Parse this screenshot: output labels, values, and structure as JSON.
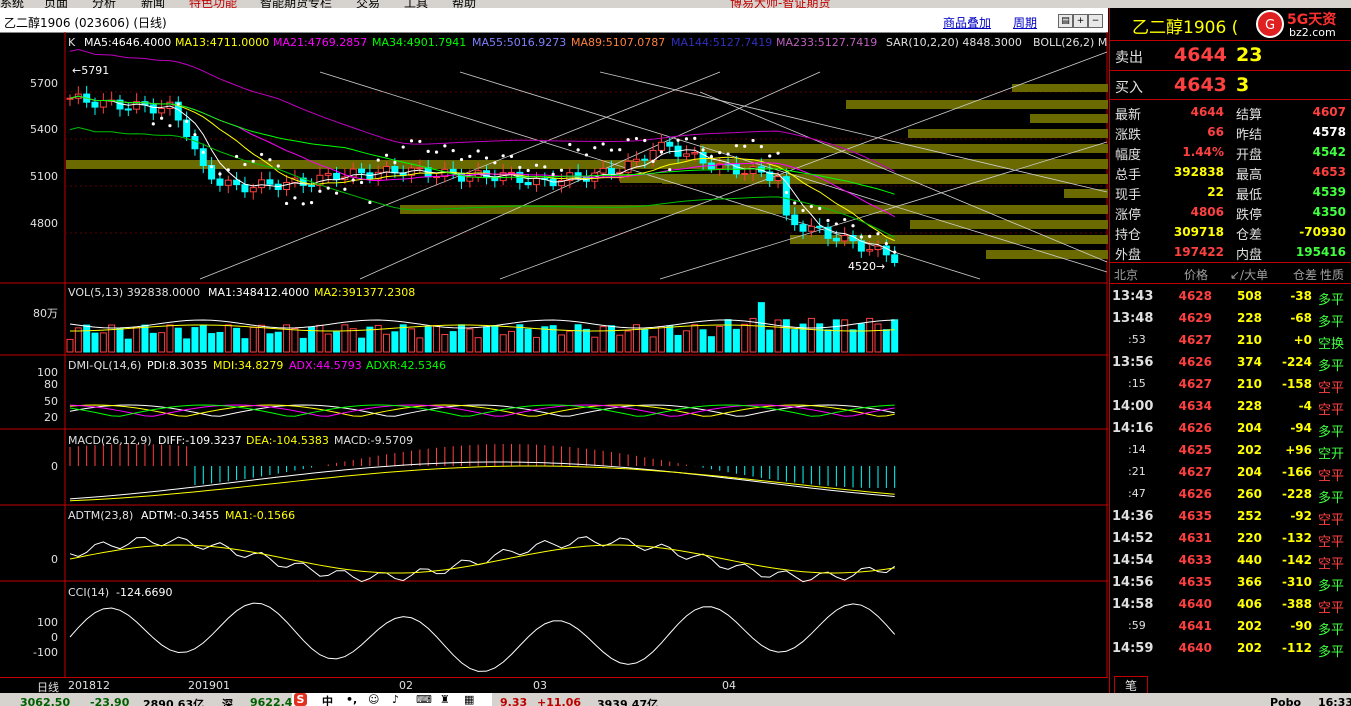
{
  "menu": [
    "系统",
    "页面",
    "分析",
    "新闻",
    "特色功能",
    "智能期货专栏",
    "交易",
    "工具",
    "帮助"
  ],
  "menu_banner": "博易大师-智证期货",
  "title": "乙二醇1906 (023606) (日线)",
  "toolbar_links": [
    "商品叠加",
    "周期"
  ],
  "ma_line": {
    "k": "K",
    "ma5": "MA5:4646.4000",
    "ma13": "MA13:4711.0000",
    "ma21": "MA21:4769.2857",
    "ma34": "MA34:4901.7941",
    "ma55": "MA55:5016.9273",
    "ma89": "MA89:5107.0787",
    "ma144": "MA144:5127.7419",
    "ma233": "MA233:5127.7419",
    "sar": "SAR(10,2,20)  4848.3000",
    "boll": "BOLL(26,2) M"
  },
  "price_axis": [
    "5700",
    "5400",
    "5100",
    "4800"
  ],
  "high_mark": "5791",
  "low_mark": "4520",
  "vol_line": {
    "a": "VOL(5,13)  392838.0000",
    "b": "MA1:348412.4000",
    "c": "MA2:391377.2308"
  },
  "vol_axis": "80万",
  "dmi_line": {
    "a": "DMI-QL(14,6)",
    "b": "PDI:8.3035",
    "c": "MDI:34.8279",
    "d": "ADX:44.5793",
    "e": "ADXR:42.5346"
  },
  "dmi_axis": [
    "100",
    "80",
    "50",
    "20"
  ],
  "macd_line": {
    "a": "MACD(26,12,9)",
    "b": "DIFF:-109.3237",
    "c": "DEA:-104.5383",
    "d": "MACD:-9.5709"
  },
  "macd_axis": "0",
  "adtm_line": {
    "a": "ADTM(23,8)",
    "b": "ADTM:-0.3455",
    "c": "MA1:-0.1566"
  },
  "adtm_axis": "0",
  "cci_line": {
    "a": "CCI(14)",
    "b": "-124.6690"
  },
  "cci_axis": [
    "100",
    "0",
    "-100"
  ],
  "x_axis": {
    "period": "日线",
    "labels": [
      "201812",
      "201901",
      "02",
      "03",
      "04"
    ]
  },
  "quote": {
    "name": "乙二醇1906 (",
    "sell_label": "卖出",
    "sell_price": "4644",
    "sell_vol": "23",
    "buy_label": "买入",
    "buy_price": "4643",
    "buy_vol": "3",
    "rows": [
      {
        "k1": "最新",
        "v1": "4644",
        "c1": "red",
        "k2": "结算",
        "v2": "4607",
        "c2": "red"
      },
      {
        "k1": "涨跌",
        "v1": "66",
        "c1": "red",
        "k2": "昨结",
        "v2": "4578",
        "c2": "wht"
      },
      {
        "k1": "幅度",
        "v1": "1.44%",
        "c1": "red",
        "k2": "开盘",
        "v2": "4542",
        "c2": "green"
      },
      {
        "k1": "总手",
        "v1": "392838",
        "c1": "yel",
        "k2": "最高",
        "v2": "4653",
        "c2": "red"
      },
      {
        "k1": "现手",
        "v1": "22",
        "c1": "yel",
        "k2": "最低",
        "v2": "4539",
        "c2": "green"
      },
      {
        "k1": "涨停",
        "v1": "4806",
        "c1": "red",
        "k2": "跌停",
        "v2": "4350",
        "c2": "green"
      },
      {
        "k1": "持仓",
        "v1": "309718",
        "c1": "yel",
        "k2": "仓差",
        "v2": "-70930",
        "c2": "yel"
      },
      {
        "k1": "外盘",
        "v1": "197422",
        "c1": "red",
        "k2": "内盘",
        "v2": "195416",
        "c2": "green"
      }
    ],
    "ticks_header": [
      "北京",
      "价格",
      "↙/大单",
      "仓差",
      "性质"
    ],
    "ticks": [
      {
        "t": "13:43",
        "p": "4628",
        "v": "508",
        "d": "-38",
        "n": "多平",
        "nc": "green"
      },
      {
        "t": "13:48",
        "p": "4629",
        "v": "228",
        "d": "-68",
        "n": "多平",
        "nc": "green"
      },
      {
        "t": ":53",
        "p": "4627",
        "v": "210",
        "d": "+0",
        "n": "空换",
        "nc": "green"
      },
      {
        "t": "13:56",
        "p": "4626",
        "v": "374",
        "d": "-224",
        "n": "多平",
        "nc": "green"
      },
      {
        "t": ":15",
        "p": "4627",
        "v": "210",
        "d": "-158",
        "n": "空平",
        "nc": "red"
      },
      {
        "t": "14:00",
        "p": "4634",
        "v": "228",
        "d": "-4",
        "n": "空平",
        "nc": "red"
      },
      {
        "t": "14:16",
        "p": "4626",
        "v": "204",
        "d": "-94",
        "n": "多平",
        "nc": "green"
      },
      {
        "t": ":14",
        "p": "4625",
        "v": "202",
        "d": "+96",
        "n": "空开",
        "nc": "green"
      },
      {
        "t": ":21",
        "p": "4627",
        "v": "204",
        "d": "-166",
        "n": "空平",
        "nc": "red"
      },
      {
        "t": ":47",
        "p": "4626",
        "v": "260",
        "d": "-228",
        "n": "多平",
        "nc": "green"
      },
      {
        "t": "14:36",
        "p": "4635",
        "v": "252",
        "d": "-92",
        "n": "空平",
        "nc": "red"
      },
      {
        "t": "14:52",
        "p": "4631",
        "v": "220",
        "d": "-132",
        "n": "空平",
        "nc": "red"
      },
      {
        "t": "14:54",
        "p": "4633",
        "v": "440",
        "d": "-142",
        "n": "空平",
        "nc": "red"
      },
      {
        "t": "14:56",
        "p": "4635",
        "v": "366",
        "d": "-310",
        "n": "多平",
        "nc": "green"
      },
      {
        "t": "14:58",
        "p": "4640",
        "v": "406",
        "d": "-388",
        "n": "空平",
        "nc": "red"
      },
      {
        "t": ":59",
        "p": "4641",
        "v": "202",
        "d": "-90",
        "n": "多平",
        "nc": "green"
      },
      {
        "t": "14:59",
        "p": "4640",
        "v": "202",
        "d": "-112",
        "n": "多平",
        "nc": "green"
      }
    ],
    "tab": "笔"
  },
  "bottom_bar": [
    {
      "text": "3062.50",
      "color": "#006000"
    },
    {
      "text": "-23.90",
      "color": "#006000"
    },
    {
      "text": "2890.63亿",
      "color": "#000000"
    },
    {
      "text": "深",
      "color": "#000000"
    },
    {
      "text": "9622.41",
      "color": "#006000"
    },
    {
      "text": "9.33",
      "color": "#c00000"
    },
    {
      "text": "+11.06",
      "color": "#c00000"
    },
    {
      "text": "3939.47亿",
      "color": "#000000"
    },
    {
      "text": "Pobo",
      "color": "#000000"
    },
    {
      "text": "16:33",
      "color": "#000000"
    }
  ],
  "logo_text": "5G天资",
  "logo_sub": "bz2.com",
  "colors": {
    "up": "#ff4040",
    "down": "#00ffff",
    "ma5": "#ffffff",
    "ma13": "#ffff00",
    "ma21": "#ff00ff",
    "ma34": "#00ff00",
    "ma55": "#6060ff",
    "ma89": "#ff8040",
    "grid": "#c00000",
    "volbar": "#808000"
  }
}
